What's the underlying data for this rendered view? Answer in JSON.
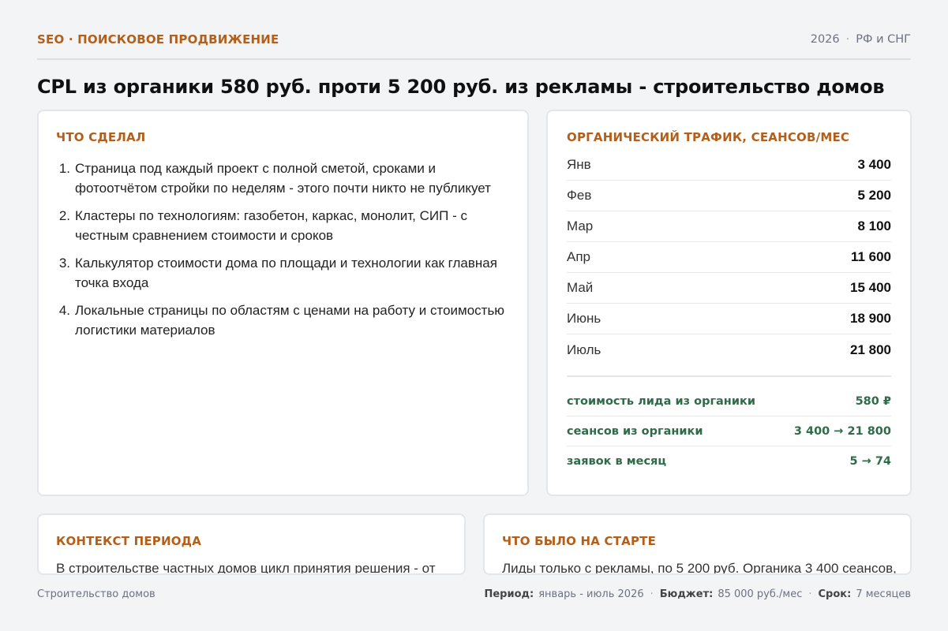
{
  "header": {
    "kicker": "SEO · ПОИСКОВОЕ ПРОДВИЖЕНИЕ",
    "year": "2026",
    "separator": "·",
    "region": "РФ и СНГ"
  },
  "headline": "CPL из органики 580 руб. проти 5 200 руб. из рекламы - строительство домов",
  "done": {
    "title": "ЧТО СДЕЛАЛ",
    "items": [
      {
        "num": "1.",
        "text": "Страница под каждый проект с полной сметой, сроками и фотоотчётом стройки по неделям - этого почти никто не публикует"
      },
      {
        "num": "2.",
        "text": "Кластеры по технологиям: газобетон, каркас, монолит, СИП - с честным сравнением стоимости и сроков"
      },
      {
        "num": "3.",
        "text": "Калькулятор стоимости дома по площади и технологии как главная точка входа"
      },
      {
        "num": "4.",
        "text": "Локальные страницы по областям с ценами на работу и стоимостью логистики материалов"
      }
    ]
  },
  "traffic": {
    "title": "ОРГАНИЧЕСКИЙ ТРАФИК, СЕАНСОВ/МЕС",
    "rows": [
      {
        "month": "Янв",
        "value": "3 400"
      },
      {
        "month": "Фев",
        "value": "5 200"
      },
      {
        "month": "Мар",
        "value": "8 100"
      },
      {
        "month": "Апр",
        "value": "11 600"
      },
      {
        "month": "Май",
        "value": "15 400"
      },
      {
        "month": "Июнь",
        "value": "18 900"
      },
      {
        "month": "Июль",
        "value": "21 800"
      }
    ],
    "summary": [
      {
        "label": "стоимость лида из органики",
        "value": "580 ₽"
      },
      {
        "label": "сеансов из органики",
        "value": "3 400 → 21 800"
      },
      {
        "label": "заявок в месяц",
        "value": "5 → 74"
      }
    ]
  },
  "context": {
    "title": "КОНТЕКСТ ПЕРИОДА",
    "text": "В строительстве частных домов цикл принятия решения - от"
  },
  "start": {
    "title": "ЧТО БЫЛО НА СТАРТЕ",
    "text": "Лиды только с рекламы, по 5 200 руб. Органика 3 400 сеансов,"
  },
  "footer": {
    "niche": "Строительство домов",
    "period_label": "Период:",
    "period_value": "январь - июль 2026",
    "budget_label": "Бюджет:",
    "budget_value": "85 000 руб./мес",
    "term_label": "Срок:",
    "term_value": "7 месяцев",
    "dot": "·"
  }
}
